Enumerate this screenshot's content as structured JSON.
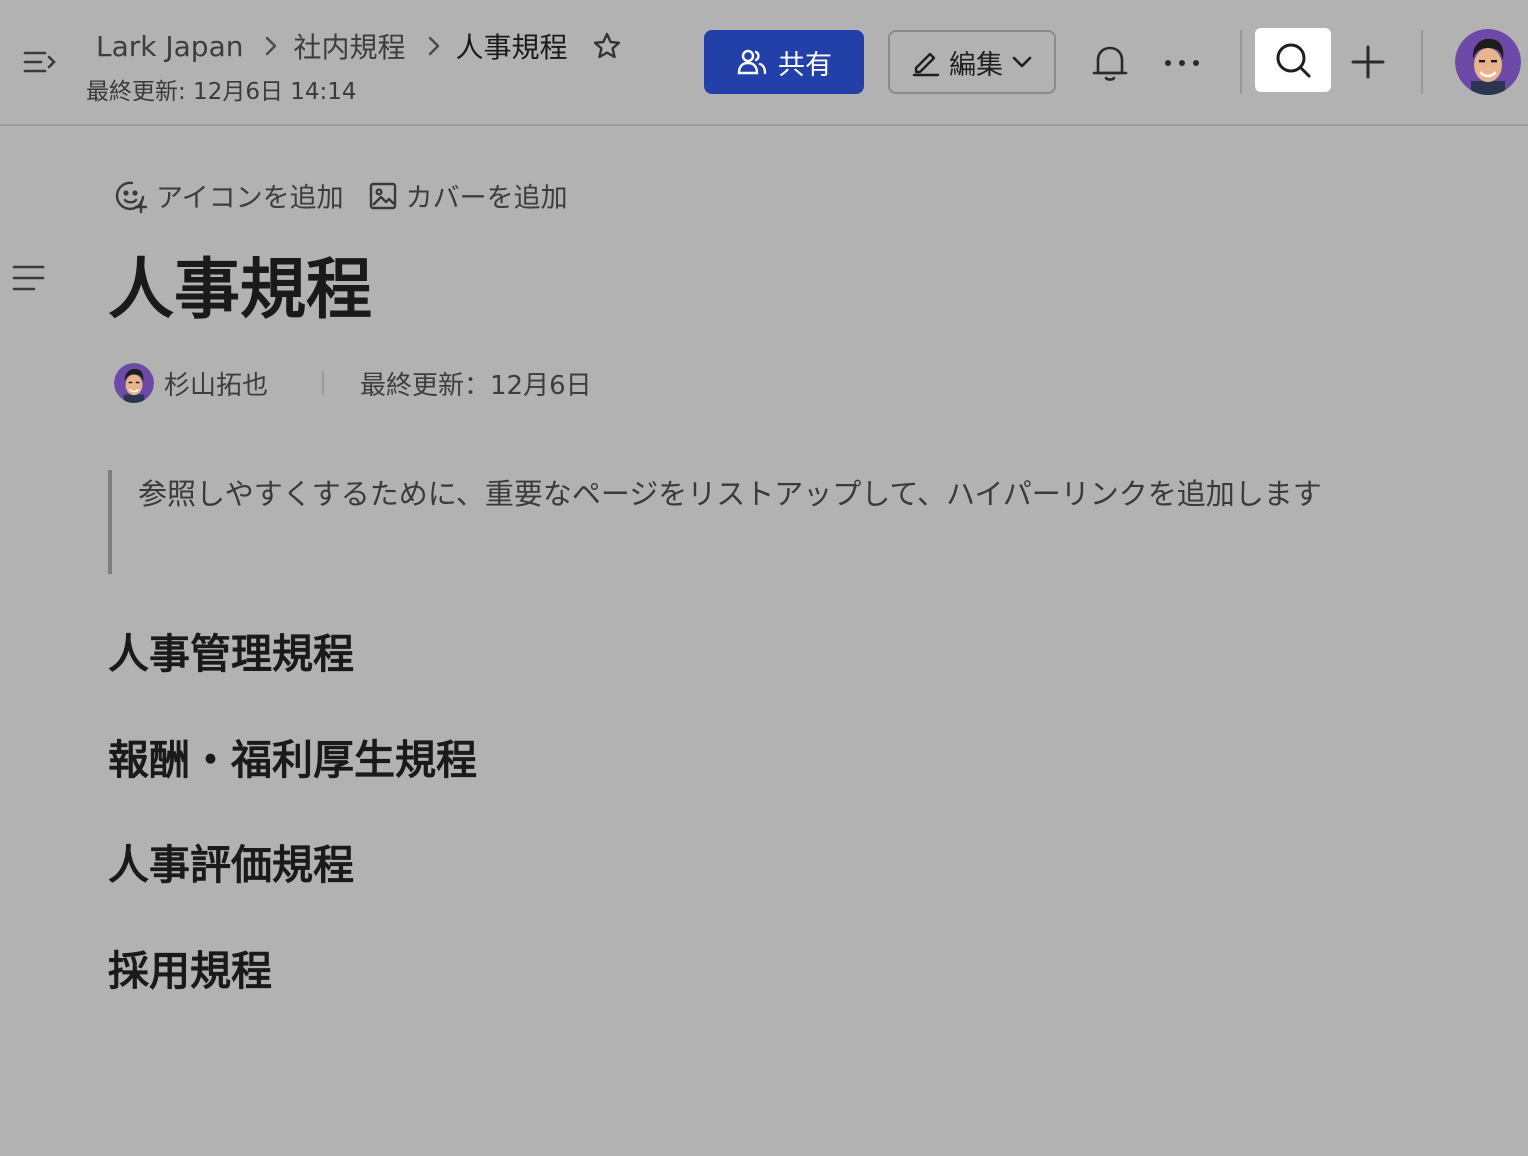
{
  "breadcrumb": {
    "items": [
      "Lark Japan",
      "社内規程",
      "人事規程"
    ]
  },
  "header": {
    "last_updated": "最終更新: 12月6日 14:14",
    "share_label": "共有",
    "edit_label": "編集"
  },
  "doc": {
    "add_icon_label": "アイコンを追加",
    "add_cover_label": "カバーを追加",
    "title": "人事規程",
    "author": "杉山拓也",
    "last_updated": "最終更新：12月6日",
    "quote": "参照しやすくするために、重要なページをリストアップして、ハイパーリンクを追加します",
    "headings": [
      "人事管理規程",
      "報酬・福利厚生規程",
      "人事評価規程",
      "採用規程"
    ]
  },
  "colors": {
    "background": "#b2b2b2",
    "share_button": "#2340a8"
  },
  "icons": [
    "sidebar-toggle-icon",
    "chevron-right-icon",
    "star-icon",
    "users-icon",
    "pencil-icon",
    "chevron-down-icon",
    "bell-icon",
    "more-icon",
    "search-icon",
    "plus-icon",
    "emoji-add-icon",
    "image-icon",
    "outline-icon"
  ]
}
